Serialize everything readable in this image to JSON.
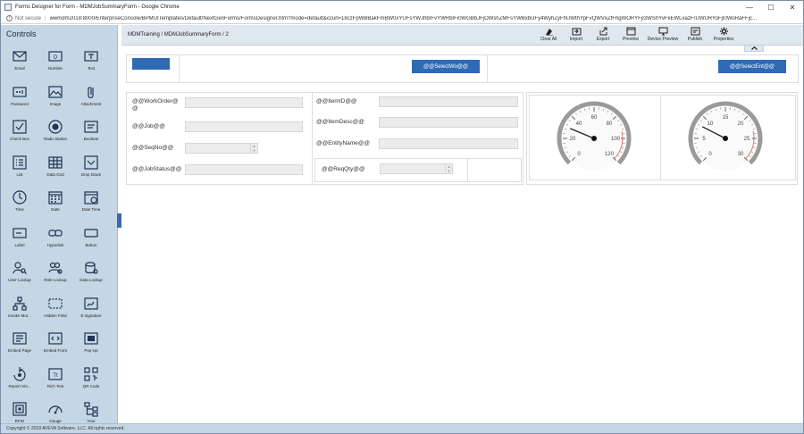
{
  "window": {
    "title": "Forms Designer for Form - MDMJobSummaryForm - Google Chrome",
    "controls": {
      "minimize": "—",
      "maximize": "☐",
      "close": "✕"
    }
  },
  "address": {
    "security": "Not secure",
    "url": "wwmdm2018:8000/EnterpriseConsole/BPMUITemplates/Default/NextGenForms/FormsDesigner.htm?mode=default&ccurl=18czFpWBBakFmBW0xYUFsYWJhbIFvYWRbIFi0WGBbJFjOWshZMFsYWBxbUFy4WyhZyFhUWthYpFvQWVxZfFhgWORYFjI3WShYvFkEWLxazFrUWURYoFjI0WoRaFFjc..."
  },
  "sidebar": {
    "header": "Controls",
    "items": [
      {
        "label": "Email",
        "icon": "envelope-icon"
      },
      {
        "label": "Number",
        "icon": "number-icon"
      },
      {
        "label": "Text",
        "icon": "text-icon"
      },
      {
        "label": "Password",
        "icon": "password-icon"
      },
      {
        "label": "Image",
        "icon": "image-icon"
      },
      {
        "label": "Attachment",
        "icon": "paperclip-icon"
      },
      {
        "label": "Check Box",
        "icon": "checkbox-icon"
      },
      {
        "label": "Radio Button",
        "icon": "radio-icon"
      },
      {
        "label": "Boolean",
        "icon": "boolean-icon"
      },
      {
        "label": "List",
        "icon": "list-icon"
      },
      {
        "label": "Data Grid",
        "icon": "grid-icon"
      },
      {
        "label": "Drop Down",
        "icon": "dropdown-icon"
      },
      {
        "label": "Time",
        "icon": "clock-icon"
      },
      {
        "label": "Date",
        "icon": "calendar-icon"
      },
      {
        "label": "Date Time",
        "icon": "datetime-icon"
      },
      {
        "label": "Label",
        "icon": "label-icon"
      },
      {
        "label": "Hyperlink",
        "icon": "link-icon"
      },
      {
        "label": "Button",
        "icon": "button-icon"
      },
      {
        "label": "User Lookup",
        "icon": "user-lookup-icon"
      },
      {
        "label": "Role Lookup",
        "icon": "role-lookup-icon"
      },
      {
        "label": "Data Lookup",
        "icon": "data-lookup-icon"
      },
      {
        "label": "Invoke Mor...",
        "icon": "sitemap-icon"
      },
      {
        "label": "Hidden Field",
        "icon": "hidden-field-icon"
      },
      {
        "label": "E-signature",
        "icon": "signature-icon"
      },
      {
        "label": "Embed Page",
        "icon": "embed-page-icon"
      },
      {
        "label": "Embed Form",
        "icon": "embed-form-icon"
      },
      {
        "label": "Pop-Up",
        "icon": "popup-icon"
      },
      {
        "label": "Report Via...",
        "icon": "report-icon"
      },
      {
        "label": "Rich Text",
        "icon": "rich-text-icon"
      },
      {
        "label": "QR Code",
        "icon": "qr-code-icon"
      },
      {
        "label": "RFID",
        "icon": "rfid-icon"
      },
      {
        "label": "Gauge",
        "icon": "gauge-icon"
      },
      {
        "label": "Tree",
        "icon": "tree-icon"
      }
    ]
  },
  "toolbar": {
    "breadcrumb": "MDMTraining / MDMJobSummaryForm / 2",
    "buttons": [
      {
        "label": "Clear All",
        "icon": "clear-all-icon"
      },
      {
        "label": "Import",
        "icon": "import-icon"
      },
      {
        "label": "Export",
        "icon": "export-icon"
      },
      {
        "label": "Preview",
        "icon": "preview-icon"
      },
      {
        "label": "Device Preview",
        "icon": "device-preview-icon"
      },
      {
        "label": "Publish",
        "icon": "publish-icon"
      },
      {
        "label": "Properties",
        "icon": "gear-icon"
      }
    ],
    "collapse_arrow": "^"
  },
  "form": {
    "top_row": {
      "select_wo": "@@SelectWo@@",
      "select_ent": "@@SelectEnt@@"
    },
    "left_fields": [
      {
        "label": "@@WorkOrder@@"
      },
      {
        "label": "@@Job@@"
      },
      {
        "label": "@@SeqNo@@"
      },
      {
        "label": "@@JobStatus@@"
      }
    ],
    "mid_fields": [
      {
        "label": "@@ItemID@@"
      },
      {
        "label": "@@ItemDesc@@"
      },
      {
        "label": "@@EntityName@@"
      },
      {
        "label": "@@ReqQty@@"
      }
    ],
    "gauges": [
      {
        "ticks": [
          "0",
          "20",
          "40",
          "60",
          "80",
          "100",
          "120"
        ],
        "min": 0,
        "max": 120,
        "value": 30
      },
      {
        "ticks": [
          "0",
          "5",
          "10",
          "15",
          "20",
          "25",
          "30"
        ],
        "min": 0,
        "max": 30,
        "value": 8
      }
    ]
  },
  "footer": {
    "copyright": "Copyright © 2018 AVEVA Software, LLC. All rights reserved."
  },
  "colors": {
    "sidebar_bg": "#c5d6e5",
    "toolbar_bg": "#dfe7ef",
    "accent": "#2f6ab5"
  }
}
